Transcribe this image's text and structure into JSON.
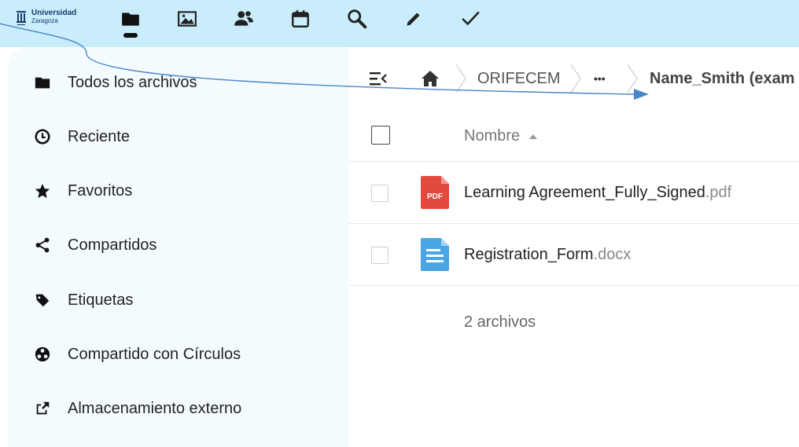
{
  "header": {
    "logo": {
      "line1": "Universidad",
      "line2": "Zaragoza"
    },
    "apps": [
      {
        "name": "files-icon",
        "active": true
      },
      {
        "name": "photos-icon"
      },
      {
        "name": "contacts-icon"
      },
      {
        "name": "calendar-icon"
      },
      {
        "name": "search-icon"
      },
      {
        "name": "notes-icon"
      },
      {
        "name": "tasks-icon"
      }
    ],
    "bg_color": "#c9edfb"
  },
  "sidebar": {
    "items": [
      {
        "label": "Todos los archivos",
        "icon": "folder-icon"
      },
      {
        "label": "Reciente",
        "icon": "clock-icon"
      },
      {
        "label": "Favoritos",
        "icon": "star-icon"
      },
      {
        "label": "Compartidos",
        "icon": "share-icon"
      },
      {
        "label": "Etiquetas",
        "icon": "tag-icon"
      },
      {
        "label": "Compartido con Círculos",
        "icon": "circles-icon"
      },
      {
        "label": "Almacenamiento externo",
        "icon": "external-storage-icon"
      }
    ]
  },
  "breadcrumb": {
    "items": [
      "ORIFECEM",
      "•••"
    ],
    "current": "Name_Smith (exam"
  },
  "table": {
    "column_name": "Nombre",
    "files": [
      {
        "base": "Learning Agreement_Fully_Signed",
        "ext": ".pdf",
        "type": "pdf",
        "badge": "PDF",
        "color": "#e04a3f"
      },
      {
        "base": "Registration_Form",
        "ext": ".docx",
        "type": "docx",
        "color": "#49a5e4"
      }
    ],
    "summary": "2 archivos"
  },
  "annotation": {
    "color": "#4a86c5"
  }
}
